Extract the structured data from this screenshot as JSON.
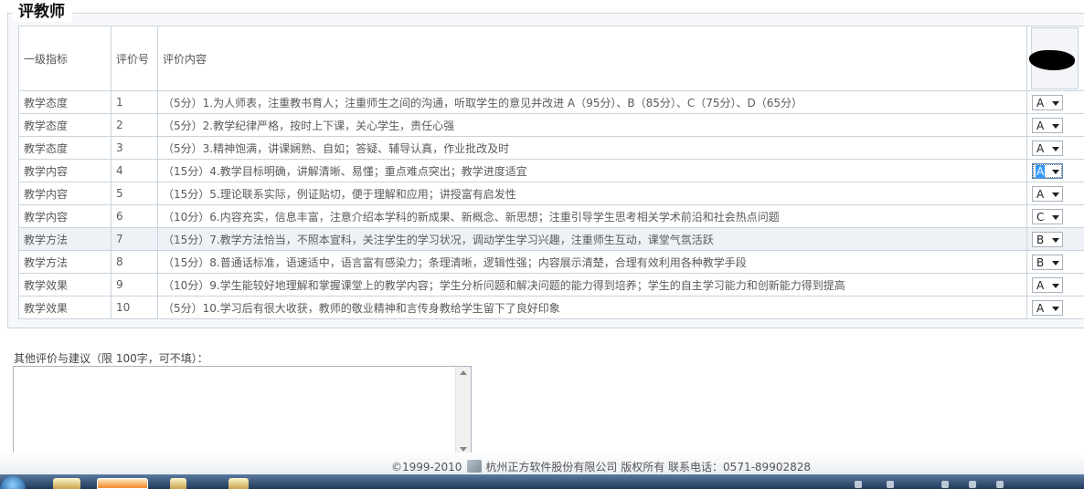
{
  "section_title": "评教师",
  "table": {
    "headers": {
      "level": "一级指标",
      "no": "评价号",
      "content": "评价内容"
    },
    "rows": [
      {
        "level": "教学态度",
        "no": "1",
        "content": "（5分）1.为人师表，注重教书育人；注重师生之间的沟通，听取学生的意见并改进 A（95分）、B（85分）、C（75分）、D（65分）",
        "grade": "A"
      },
      {
        "level": "教学态度",
        "no": "2",
        "content": "（5分）2.教学纪律严格，按时上下课，关心学生，责任心强",
        "grade": "A"
      },
      {
        "level": "教学态度",
        "no": "3",
        "content": "（5分）3.精神饱满，讲课娴熟、自如；答疑、辅导认真，作业批改及时",
        "grade": "A"
      },
      {
        "level": "教学内容",
        "no": "4",
        "content": "（15分）4.教学目标明确，讲解清晰、易懂；重点难点突出；教学进度适宜",
        "grade": "A"
      },
      {
        "level": "教学内容",
        "no": "5",
        "content": "（15分）5.理论联系实际，例证贴切，便于理解和应用；讲授富有启发性",
        "grade": "A"
      },
      {
        "level": "教学内容",
        "no": "6",
        "content": "（10分）6.内容充实，信息丰富，注意介绍本学科的新成果、新概念、新思想；注重引导学生思考相关学术前沿和社会热点问题",
        "grade": "C"
      },
      {
        "level": "教学方法",
        "no": "7",
        "content": "（15分）7.教学方法恰当，不照本宣科，关注学生的学习状况，调动学生学习兴趣，注重师生互动，课堂气氛活跃",
        "grade": "B"
      },
      {
        "level": "教学方法",
        "no": "8",
        "content": "（15分）8.普通话标准，语速适中，语言富有感染力；条理清晰，逻辑性强；内容展示清楚，合理有效利用各种教学手段",
        "grade": "B"
      },
      {
        "level": "教学效果",
        "no": "9",
        "content": "（10分）9.学生能较好地理解和掌握课堂上的教学内容；学生分析问题和解决问题的能力得到培养；学生的自主学习能力和创新能力得到提高",
        "grade": "A"
      },
      {
        "level": "教学效果",
        "no": "10",
        "content": "（5分）10.学习后有很大收获，教师的敬业精神和言传身教给学生留下了良好印象",
        "grade": "A"
      }
    ]
  },
  "comment": {
    "label": "其他评价与建议（限 100字，可不填）：",
    "value": ""
  },
  "footer": {
    "text": "©1999-2010",
    "company": "杭州正方软件股份有限公司  版权所有  联系电话：0571-89902828"
  }
}
